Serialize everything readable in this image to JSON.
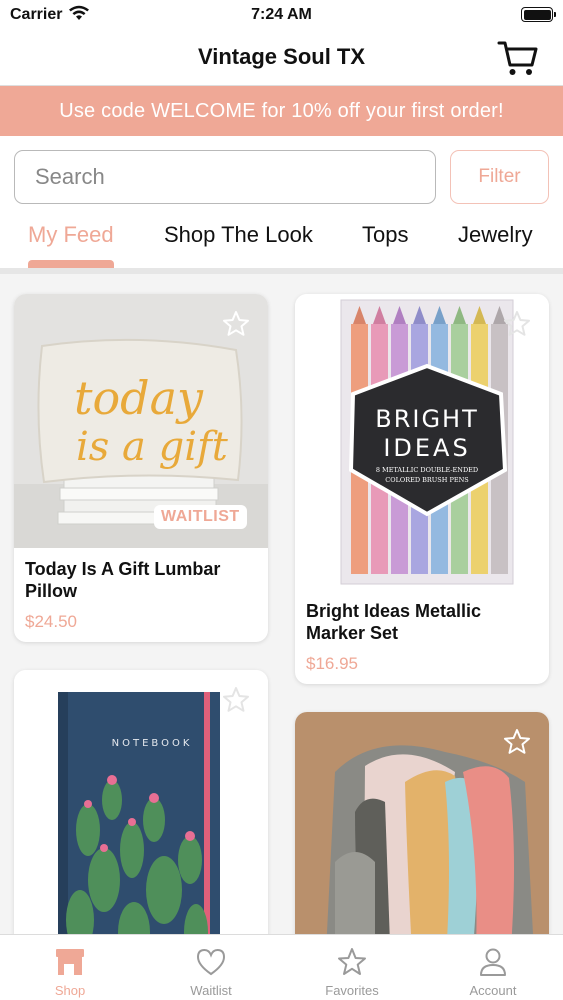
{
  "status_bar": {
    "carrier": "Carrier",
    "time": "7:24 AM"
  },
  "nav": {
    "title": "Vintage Soul TX",
    "cart_icon": "cart-icon"
  },
  "promo": {
    "text": "Use code WELCOME for 10% off your first order!"
  },
  "search": {
    "placeholder": "Search",
    "value": ""
  },
  "filter": {
    "label": "Filter"
  },
  "tabs": [
    {
      "label": "My Feed",
      "active": true
    },
    {
      "label": "Shop The Look",
      "active": false
    },
    {
      "label": "Tops",
      "active": false
    },
    {
      "label": "Jewelry",
      "active": false
    }
  ],
  "products": [
    {
      "title": "Today Is A Gift Lumbar Pillow",
      "title_line1": "Today Is A Gift Lumbar",
      "title_line2": "Pillow",
      "price": "$24.50",
      "badge": "WAITLIST",
      "pillow_text_line1": "today",
      "pillow_text_line2": "is a gift"
    },
    {
      "title": "Bright Ideas Metallic Marker Set",
      "title_line1": "Bright Ideas Metallic",
      "title_line2": "Marker Set",
      "price": "$16.95",
      "box_line1": "BRIGHT",
      "box_line2": "IDEAS",
      "box_sub1": "8 METALLIC DOUBLE-ENDED",
      "box_sub2": "COLORED BRUSH PENS"
    },
    {
      "notebook_label": "NOTEBOOK"
    },
    {}
  ],
  "tab_bar": [
    {
      "label": "Shop",
      "icon": "shop-icon",
      "active": true
    },
    {
      "label": "Waitlist",
      "icon": "heart-icon",
      "active": false
    },
    {
      "label": "Favorites",
      "icon": "star-icon",
      "active": false
    },
    {
      "label": "Account",
      "icon": "person-icon",
      "active": false
    }
  ],
  "colors": {
    "accent": "#efa896",
    "text": "#111111",
    "inactive": "#9a9a9a"
  }
}
